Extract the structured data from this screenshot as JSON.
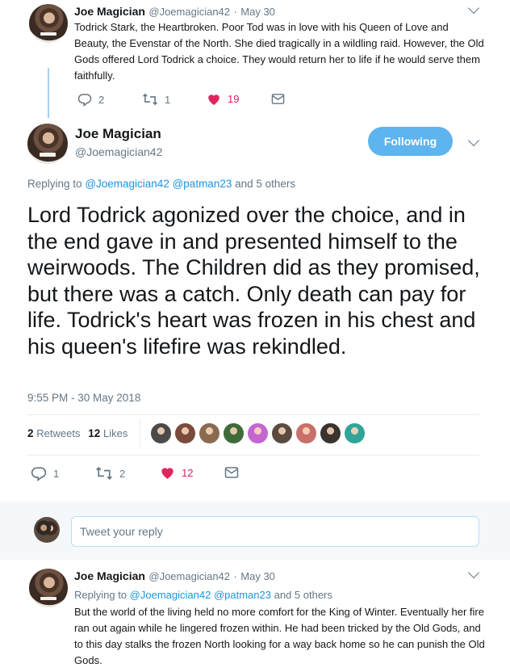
{
  "prev_tweet": {
    "author_name": "Joe Magician",
    "handle": "@Joemagician42",
    "date": "May 30",
    "text": "Todrick Stark, the Heartbroken. Poor Tod was in love with his Queen of Love and Beauty, the Evenstar of the North. She died tragically in a wildling raid. However, the Old Gods offered Lord Todrick a choice. They would return her to life if he would serve them faithfully.",
    "reply_count": "2",
    "retweet_count": "1",
    "like_count": "19"
  },
  "main_tweet": {
    "author_name": "Joe Magician",
    "handle": "@Joemagician42",
    "follow_label": "Following",
    "replying_prefix": "Replying to",
    "replying_users": [
      "@Joemagician42",
      "@patman23"
    ],
    "replying_suffix": "and 5 others",
    "text": "Lord Todrick agonized over the choice, and in the end gave in and presented himself to the weirwoods. The Children did as they promised, but there was a catch. Only death can pay for life. Todrick's heart was frozen in his chest and his queen's lifefire was rekindled.",
    "timestamp": "9:55 PM - 30 May 2018",
    "retweets_number": "2",
    "retweets_label": "Retweets",
    "likes_number": "12",
    "likes_label": "Likes",
    "reply_count": "1",
    "retweet_count": "2",
    "like_count": "12"
  },
  "reply_box": {
    "placeholder": "Tweet your reply"
  },
  "next_tweet": {
    "author_name": "Joe Magician",
    "handle": "@Joemagician42",
    "date": "May 30",
    "replying_prefix": "Replying to",
    "replying_users": [
      "@Joemagician42",
      "@patman23"
    ],
    "replying_suffix": "and 5 others",
    "text": "But the world of the living held no more comfort for the King of Winter. Eventually her fire ran out again while he lingered frozen within. He had been tricked by the Old Gods, and to this day stalks the frozen North looking for a way back home so he can punish the Old Gods."
  },
  "liker_colors": [
    "#4a4a4a",
    "#7a4b3c",
    "#8b6a52",
    "#3f6b3a",
    "#c466d0",
    "#5a4a40",
    "#c9706a",
    "#3a3330",
    "#2fa59a"
  ],
  "colors": {
    "accent": "#1b95e0",
    "follow_button": "#5eb4ee",
    "like_red": "#e0245e",
    "muted_text": "#657786",
    "thread_line": "#a6d0f0"
  }
}
